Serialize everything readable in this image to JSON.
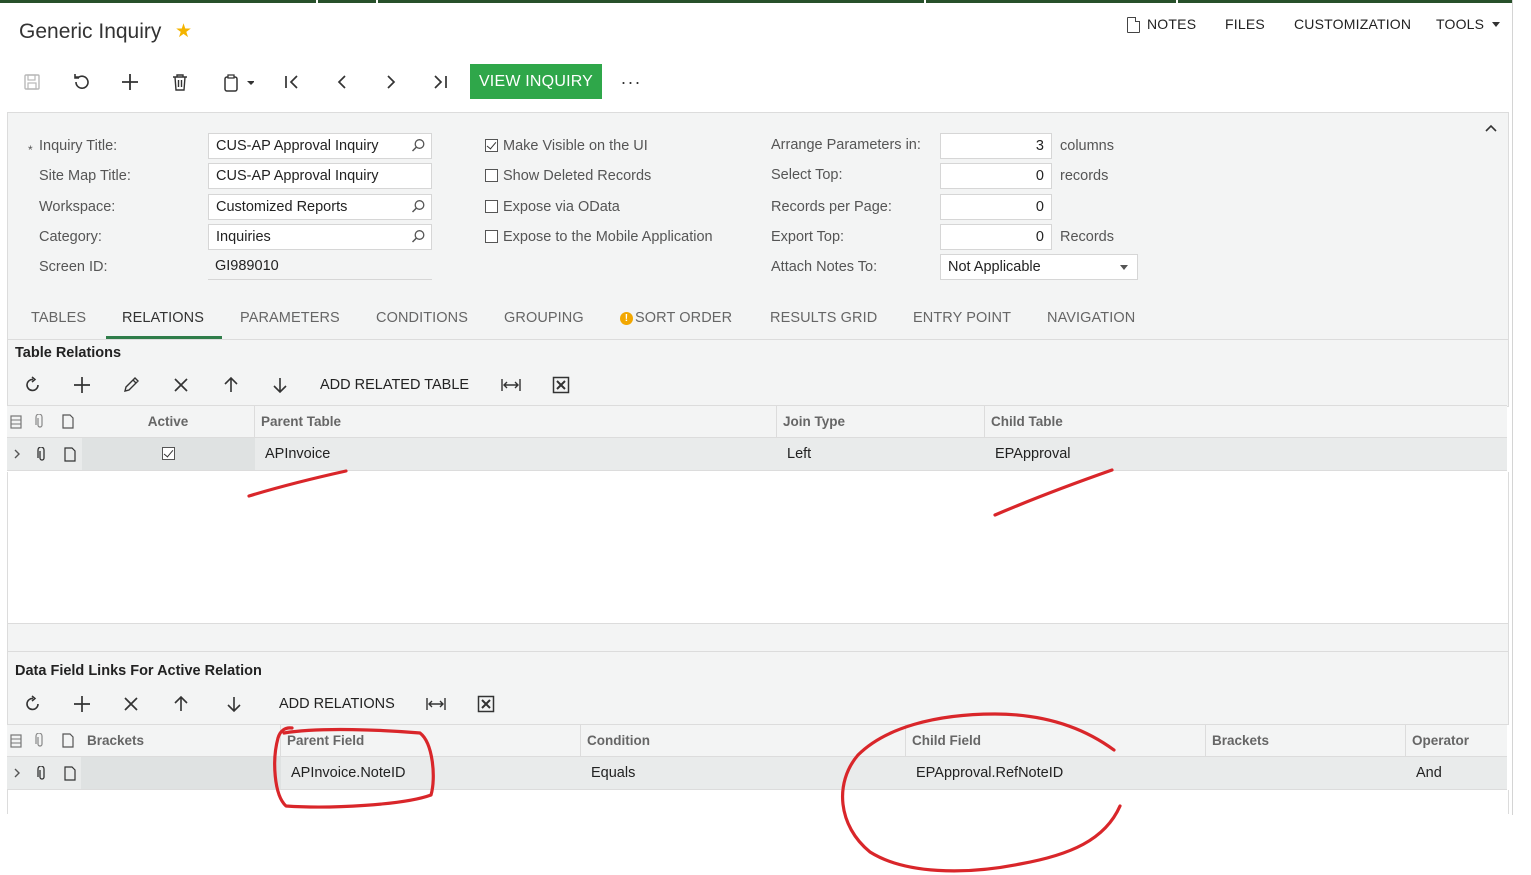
{
  "screen": {
    "title": "Generic Inquiry",
    "top_menu": {
      "notes": "NOTES",
      "files": "FILES",
      "customization": "CUSTOMIZATION",
      "tools": "TOOLS"
    }
  },
  "toolbar": {
    "icons": [
      "save-icon",
      "undo-icon",
      "add-icon",
      "delete-icon",
      "copy-paste-icon",
      "first-record-icon",
      "previous-record-icon",
      "next-record-icon",
      "last-record-icon",
      "more-icon"
    ],
    "view_inquiry": "VIEW INQUIRY",
    "more": "···",
    "accent_color": "#2fa74a"
  },
  "form": {
    "inquiry_title": {
      "label": "Inquiry Title:",
      "required_mark": "*",
      "value": "CUS-AP Approval Inquiry"
    },
    "site_map_title": {
      "label": "Site Map Title:",
      "value": "CUS-AP Approval Inquiry"
    },
    "workspace": {
      "label": "Workspace:",
      "value": "Customized Reports"
    },
    "category": {
      "label": "Category:",
      "value": "Inquiries"
    },
    "screen_id": {
      "label": "Screen ID:",
      "value": "GI989010"
    },
    "make_visible": {
      "label": "Make Visible on the UI",
      "checked": true
    },
    "show_deleted": {
      "label": "Show Deleted Records",
      "checked": false
    },
    "expose_odata": {
      "label": "Expose via OData",
      "checked": false
    },
    "expose_mobile": {
      "label": "Expose to the Mobile Application",
      "checked": false
    },
    "arrange_params": {
      "label": "Arrange Parameters in:",
      "value": "3",
      "unit": "columns"
    },
    "select_top": {
      "label": "Select Top:",
      "value": "0",
      "unit": "records"
    },
    "records_per_page": {
      "label": "Records per Page:",
      "value": "0"
    },
    "export_top": {
      "label": "Export Top:",
      "value": "0",
      "unit": "Records"
    },
    "attach_notes": {
      "label": "Attach Notes To:",
      "value": "Not Applicable"
    }
  },
  "tabs": [
    {
      "label": "TABLES",
      "active": false
    },
    {
      "label": "RELATIONS",
      "active": true
    },
    {
      "label": "PARAMETERS",
      "active": false
    },
    {
      "label": "CONDITIONS",
      "active": false
    },
    {
      "label": "GROUPING",
      "active": false
    },
    {
      "label": "SORT ORDER",
      "active": false,
      "warning": "!"
    },
    {
      "label": "RESULTS GRID",
      "active": false
    },
    {
      "label": "ENTRY POINT",
      "active": false
    },
    {
      "label": "NAVIGATION",
      "active": false
    }
  ],
  "table_relations": {
    "title": "Table Relations",
    "add_button": "ADD RELATED TABLE",
    "columns": {
      "active": "Active",
      "parent_table": "Parent Table",
      "join_type": "Join Type",
      "child_table": "Child Table"
    },
    "rows": [
      {
        "active": true,
        "parent_table": "APInvoice",
        "join_type": "Left",
        "child_table": "EPApproval"
      }
    ]
  },
  "data_field_links": {
    "title": "Data Field Links For Active Relation",
    "add_button": "ADD RELATIONS",
    "columns": {
      "brackets_open": "Brackets",
      "parent_field": "Parent Field",
      "condition": "Condition",
      "child_field": "Child Field",
      "brackets_close": "Brackets",
      "operator": "Operator"
    },
    "rows": [
      {
        "brackets_open": "",
        "parent_field": "APInvoice.NoteID",
        "condition": "Equals",
        "child_field": "EPApproval.RefNoteID",
        "brackets_close": "",
        "operator": "And"
      }
    ]
  },
  "annotation_color": "#d9262a"
}
